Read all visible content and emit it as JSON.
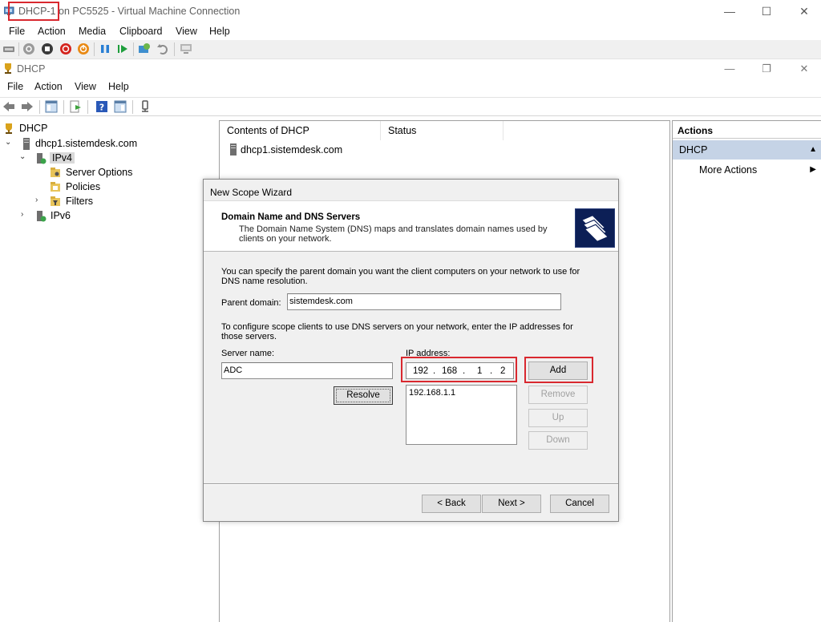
{
  "vm_window": {
    "title": "DHCP-1 on PC5525 - Virtual Machine Connection",
    "menu": [
      "File",
      "Action",
      "Media",
      "Clipboard",
      "View",
      "Help"
    ],
    "toolbar_icons": [
      "ctrl-alt-del-icon",
      "start-icon",
      "turn-off-icon",
      "shutdown-icon",
      "power-icon",
      "pause-icon",
      "resume-icon",
      "checkpoint-icon",
      "revert-icon",
      "enhanced-session-icon"
    ]
  },
  "mmc": {
    "title": "DHCP",
    "menu": [
      "File",
      "Action",
      "View",
      "Help"
    ],
    "toolbar_icons": [
      "back-icon",
      "forward-icon",
      "show-hide-console-tree-icon",
      "export-list-icon",
      "help-icon",
      "show-hide-action-pane-icon",
      "properties-icon"
    ],
    "tree": [
      {
        "label": "DHCP",
        "level": 0,
        "expanded": true
      },
      {
        "label": "dhcp1.sistemdesk.com",
        "level": 1,
        "expanded": true
      },
      {
        "label": "IPv4",
        "level": 2,
        "expanded": true,
        "selected": true
      },
      {
        "label": "Server Options",
        "level": 3
      },
      {
        "label": "Policies",
        "level": 3
      },
      {
        "label": "Filters",
        "level": 3,
        "expanded": false
      },
      {
        "label": "IPv6",
        "level": 2,
        "expanded": false
      }
    ],
    "columns": [
      "Contents of DHCP",
      "Status"
    ],
    "rows": [
      "dhcp1.sistemdesk.com"
    ],
    "actions": {
      "header": "Actions",
      "section": "DHCP",
      "items": [
        "More Actions"
      ]
    }
  },
  "wizard": {
    "title": "New Scope Wizard",
    "heading": "Domain Name and DNS Servers",
    "subheading": "The Domain Name System (DNS) maps and translates domain names used by clients on your network.",
    "intro": "You can specify the parent domain you want the client computers on your network to use for DNS name resolution.",
    "parent_domain_label": "Parent domain:",
    "parent_domain_value": "sistemdesk.com",
    "dns_text": "To configure scope clients to use DNS servers on your network, enter the IP addresses for those servers.",
    "server_name_label": "Server name:",
    "server_name_value": "ADC",
    "ip_label": "IP address:",
    "ip_octets": [
      "192",
      "168",
      "1",
      "2"
    ],
    "ip_list": [
      "192.168.1.1"
    ],
    "buttons": {
      "resolve": "Resolve",
      "add": "Add",
      "remove": "Remove",
      "up": "Up",
      "down": "Down",
      "back": "< Back",
      "next": "Next >",
      "cancel": "Cancel"
    }
  },
  "colors": {
    "highlight_red": "#d9282f",
    "actions_selected": "#c5d3e6",
    "wizard_logo": "#0c1f56"
  }
}
